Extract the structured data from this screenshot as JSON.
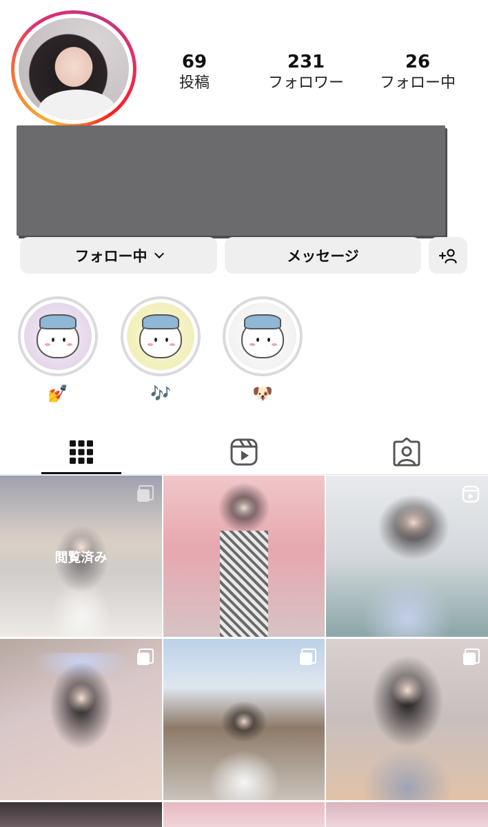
{
  "profile": {
    "stats": [
      {
        "value": "69",
        "label": "投稿"
      },
      {
        "value": "231",
        "label": "フォロワー"
      },
      {
        "value": "26",
        "label": "フォロー中"
      }
    ]
  },
  "actions": {
    "following_label": "フォロー中",
    "message_label": "メッセージ",
    "suggest_icon": "add-person-icon"
  },
  "highlights": [
    {
      "emoji": "💅",
      "colors": [
        "#f3e9f3",
        "#d7c9e6"
      ]
    },
    {
      "emoji": "🎶",
      "colors": [
        "#f7f5d2",
        "#ebe6a8"
      ]
    },
    {
      "emoji": "🐶",
      "colors": [
        "#f5f5f5",
        "#e6e6e6"
      ]
    }
  ],
  "tabs": [
    {
      "icon": "grid-icon",
      "active": true
    },
    {
      "icon": "reels-icon",
      "active": false
    },
    {
      "icon": "tagged-icon",
      "active": false
    }
  ],
  "grid": {
    "viewed_label": "閲覧済み",
    "posts": [
      {
        "type": "carousel",
        "viewed": true
      },
      {
        "type": "photo",
        "viewed": false
      },
      {
        "type": "reel",
        "viewed": false
      },
      {
        "type": "carousel",
        "viewed": false
      },
      {
        "type": "carousel",
        "viewed": false
      },
      {
        "type": "carousel",
        "viewed": false
      }
    ]
  },
  "colors": {
    "button_bg": "#efefef",
    "text": "#111111",
    "story_ring": [
      "#f9b233",
      "#e1306c",
      "#c13584"
    ]
  }
}
